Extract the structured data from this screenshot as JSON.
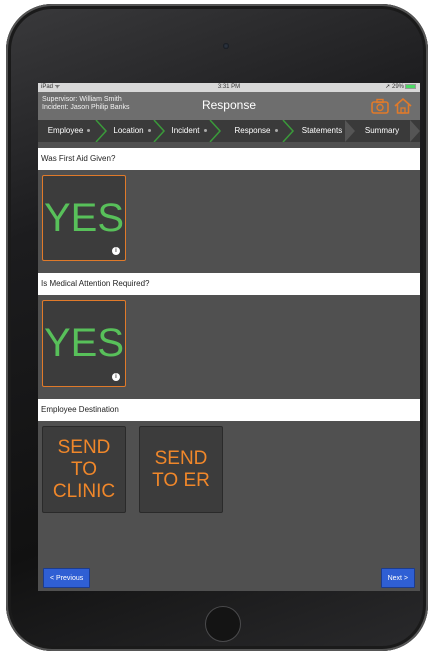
{
  "status_bar": {
    "device": "iPad",
    "time": "3:31 PM",
    "battery": "29%"
  },
  "header": {
    "supervisor": "Supervisor: William Smith",
    "incident": "Incident: Jason Philip Banks",
    "title": "Response",
    "accent_color": "#e07a2a"
  },
  "steps": [
    {
      "label": "Employee"
    },
    {
      "label": "Location"
    },
    {
      "label": "Incident"
    },
    {
      "label": "Response"
    },
    {
      "label": "Statements"
    },
    {
      "label": "Summary"
    }
  ],
  "questions": [
    {
      "label": "Was First Aid Given?",
      "answer": "YES",
      "info": "i"
    },
    {
      "label": "Is Medical Attention Required?",
      "answer": "YES",
      "info": "i"
    }
  ],
  "destination": {
    "label": "Employee Destination",
    "options": [
      {
        "label": "SEND\nTO\nCLINIC"
      },
      {
        "label": "SEND\nTO ER"
      }
    ]
  },
  "nav": {
    "previous": "< Previous",
    "next": "Next >"
  },
  "colors": {
    "yes": "#58c05a",
    "send": "#f0872a",
    "nav": "#2f5fd4",
    "step_chevron": "#3a9a3a"
  }
}
